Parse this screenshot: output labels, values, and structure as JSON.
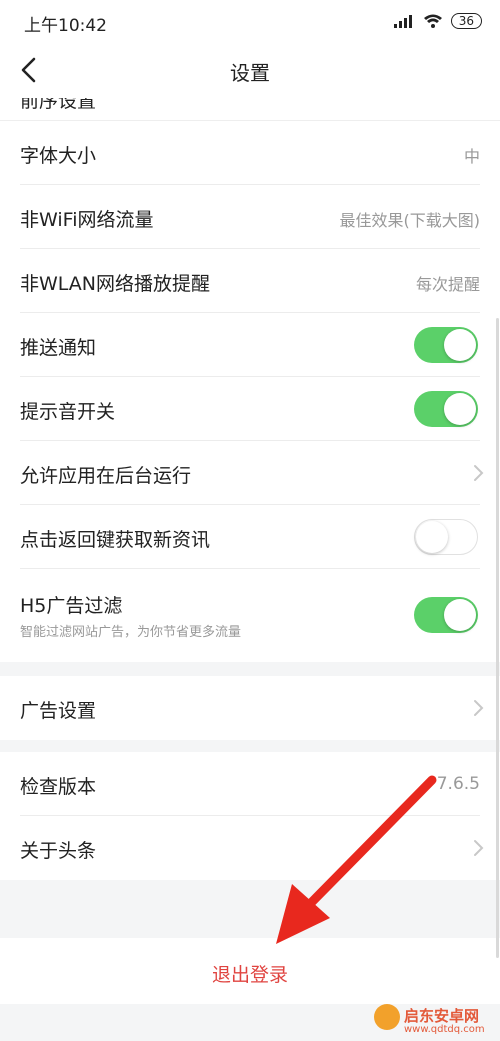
{
  "status_bar": {
    "time": "上午10:42",
    "battery": "36"
  },
  "nav": {
    "title": "设置"
  },
  "settings": {
    "partial_label": "前序设置",
    "font_size": {
      "label": "字体大小",
      "value": "中"
    },
    "non_wifi": {
      "label": "非WiFi网络流量",
      "value": "最佳效果(下载大图)"
    },
    "non_wlan": {
      "label": "非WLAN网络播放提醒",
      "value": "每次提醒"
    },
    "push": {
      "label": "推送通知",
      "state": "on"
    },
    "sound": {
      "label": "提示音开关",
      "state": "on"
    },
    "background": {
      "label": "允许应用在后台运行"
    },
    "back_refresh": {
      "label": "点击返回键获取新资讯",
      "state": "off"
    },
    "h5_filter": {
      "label": "H5广告过滤",
      "sublabel": "智能过滤网站广告，为你节省更多流量",
      "state": "on"
    },
    "ad_settings": {
      "label": "广告设置"
    },
    "check_version": {
      "label": "检查版本",
      "value": "7.6.5"
    },
    "about": {
      "label": "关于头条"
    }
  },
  "logout": {
    "label": "退出登录"
  },
  "watermark": {
    "title": "启东安卓网",
    "url": "www.qdtdq.com"
  },
  "colors": {
    "toggle_on": "#5bd069",
    "logout": "#e04440",
    "arrow": "#e8281e"
  }
}
